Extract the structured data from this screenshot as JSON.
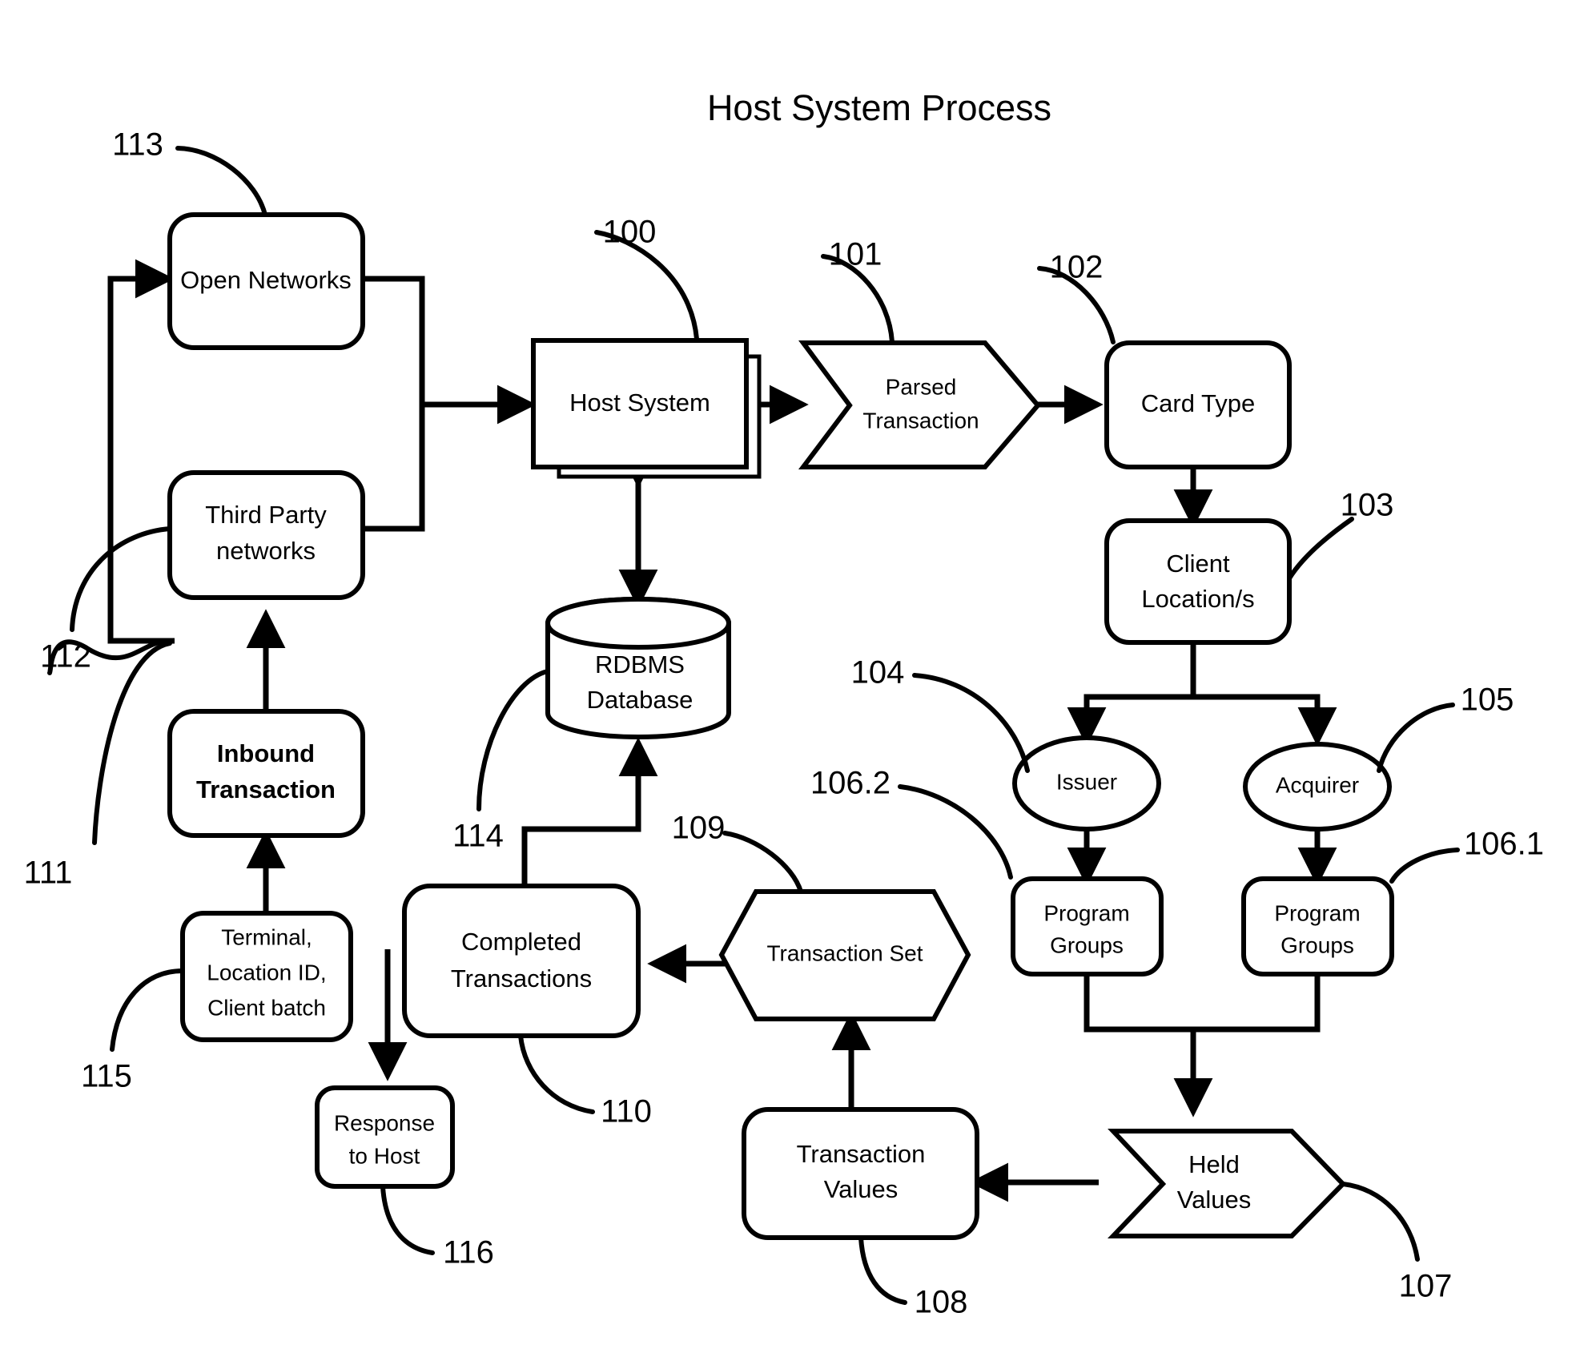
{
  "diagram": {
    "title": "Host System Process",
    "nodes": {
      "open_networks": {
        "label": "Open Networks",
        "ref": "113",
        "shape": "rounded-rect"
      },
      "third_party": {
        "label_line1": "Third Party",
        "label_line2": "networks",
        "ref": "112",
        "shape": "rounded-rect"
      },
      "inbound_transaction": {
        "label_line1": "Inbound",
        "label_line2": "Transaction",
        "ref": "111",
        "shape": "rounded-rect"
      },
      "terminal": {
        "label_line1": "Terminal,",
        "label_line2": "Location ID,",
        "label_line3": "Client batch",
        "ref": "115",
        "shape": "rounded-rect"
      },
      "host_system": {
        "label": "Host System",
        "ref": "100",
        "shape": "stacked-rect"
      },
      "parsed_transaction": {
        "label_line1": "Parsed",
        "label_line2": "Transaction",
        "ref": "101",
        "shape": "chevron"
      },
      "card_type": {
        "label": "Card Type",
        "ref": "102",
        "shape": "rounded-rect"
      },
      "client_locations": {
        "label_line1": "Client",
        "label_line2": "Location/s",
        "ref": "103",
        "shape": "rounded-rect"
      },
      "issuer": {
        "label": "Issuer",
        "ref": "104",
        "shape": "ellipse"
      },
      "acquirer": {
        "label": "Acquirer",
        "ref": "105",
        "shape": "ellipse"
      },
      "program_groups_issuer": {
        "label_line1": "Program",
        "label_line2": "Groups",
        "ref": "106.2",
        "shape": "rounded-rect"
      },
      "program_groups_acquirer": {
        "label_line1": "Program",
        "label_line2": "Groups",
        "ref": "106.1",
        "shape": "rounded-rect"
      },
      "held_values": {
        "label_line1": "Held",
        "label_line2": "Values",
        "ref": "107",
        "shape": "chevron"
      },
      "transaction_values": {
        "label_line1": "Transaction",
        "label_line2": "Values",
        "ref": "108",
        "shape": "rounded-rect"
      },
      "transaction_set": {
        "label": "Transaction Set",
        "ref": "109",
        "shape": "hexagon"
      },
      "completed_transactions": {
        "label_line1": "Completed",
        "label_line2": "Transactions",
        "ref": "110",
        "shape": "rounded-rect"
      },
      "rdbms_database": {
        "label_line1": "RDBMS",
        "label_line2": "Database",
        "ref": "114",
        "shape": "cylinder"
      },
      "response_to_host": {
        "label_line1": "Response",
        "label_line2": "to Host",
        "ref": "116",
        "shape": "rounded-rect"
      }
    }
  },
  "chart_data": {
    "type": "diagram",
    "title": "Host System Process",
    "node_labels": [
      "Open Networks",
      "Third Party networks",
      "Inbound Transaction",
      "Terminal, Location ID, Client batch",
      "Host System",
      "Parsed Transaction",
      "Card Type",
      "Client Location/s",
      "Issuer",
      "Acquirer",
      "Program Groups",
      "Program Groups",
      "Held Values",
      "Transaction Values",
      "Transaction Set",
      "Completed Transactions",
      "RDBMS Database",
      "Response to Host"
    ],
    "reference_numerals": [
      "100",
      "101",
      "102",
      "103",
      "104",
      "105",
      "106.1",
      "106.2",
      "107",
      "108",
      "109",
      "110",
      "111",
      "112",
      "113",
      "114",
      "115",
      "116"
    ],
    "edges": [
      {
        "from": "Terminal, Location ID, Client batch",
        "to": "Inbound Transaction"
      },
      {
        "from": "Inbound Transaction",
        "to": "Third Party networks"
      },
      {
        "from": "Inbound Transaction",
        "to": "Open Networks"
      },
      {
        "from": "Open Networks",
        "to": "Host System"
      },
      {
        "from": "Third Party networks",
        "to": "Host System"
      },
      {
        "from": "Host System",
        "to": "Parsed Transaction"
      },
      {
        "from": "Host System",
        "to": "RDBMS Database",
        "bidirectional": true
      },
      {
        "from": "Parsed Transaction",
        "to": "Card Type"
      },
      {
        "from": "Card Type",
        "to": "Client Location/s"
      },
      {
        "from": "Client Location/s",
        "to": "Issuer"
      },
      {
        "from": "Client Location/s",
        "to": "Acquirer"
      },
      {
        "from": "Issuer",
        "to": "Program Groups"
      },
      {
        "from": "Acquirer",
        "to": "Program Groups"
      },
      {
        "from": "Program Groups",
        "to": "Held Values"
      },
      {
        "from": "Held Values",
        "to": "Transaction Values"
      },
      {
        "from": "Transaction Values",
        "to": "Transaction Set"
      },
      {
        "from": "Transaction Set",
        "to": "Completed Transactions"
      },
      {
        "from": "Completed Transactions",
        "to": "RDBMS Database"
      },
      {
        "from": "Completed Transactions",
        "to": "Response to Host"
      }
    ]
  }
}
